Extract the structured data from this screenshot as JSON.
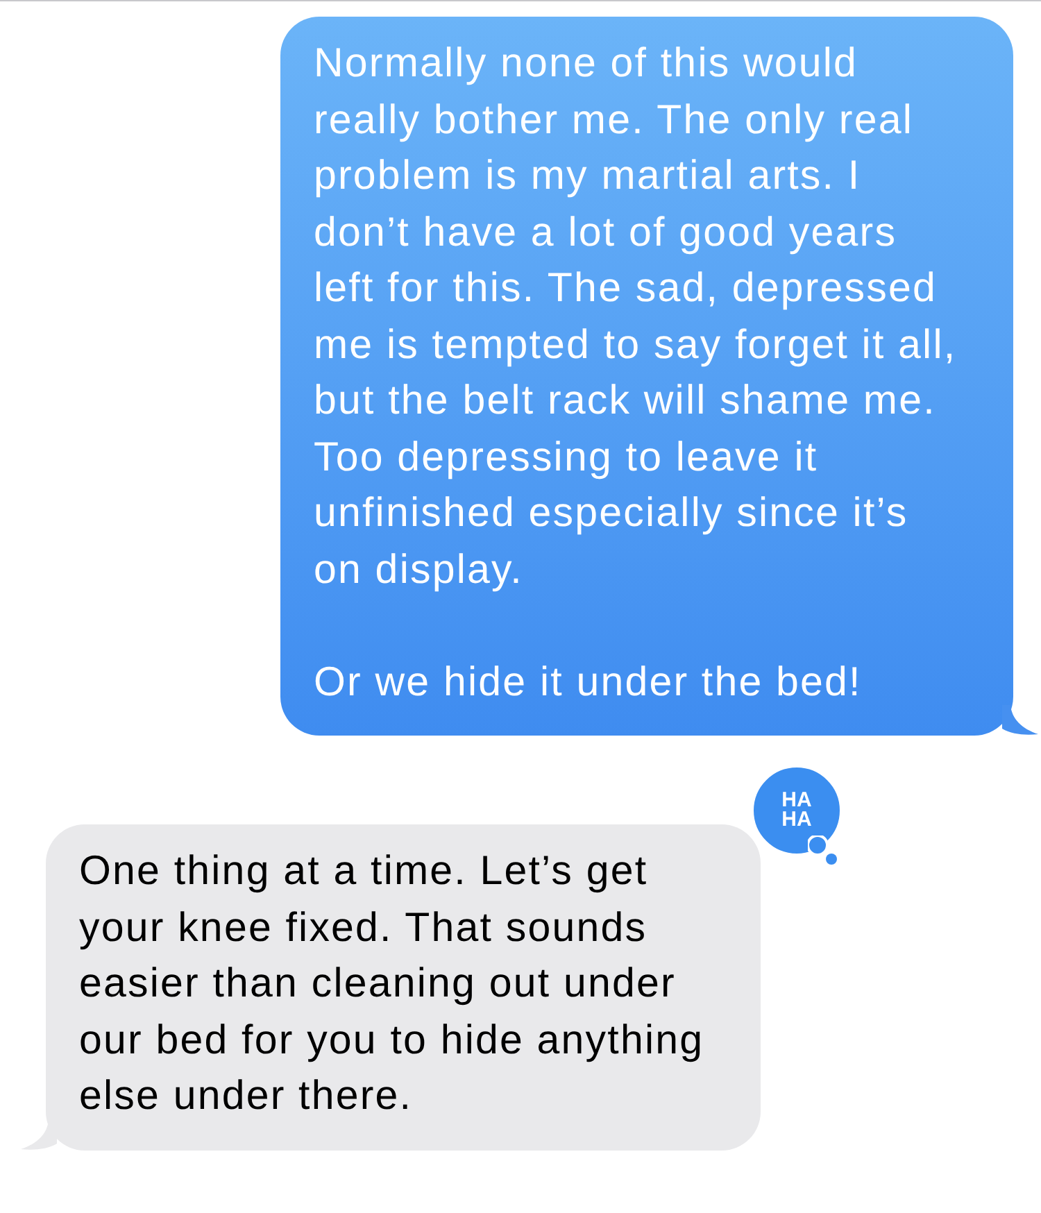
{
  "messages": [
    {
      "kind": "sent",
      "paragraphs": [
        "Normally none of this would really bother me. The only real problem is my martial arts. I don’t have a lot of good years left for this. The sad, depressed me is tempted to say forget it all, but the belt rack will shame me. Too depressing to leave it unfinished especially since it’s on display.",
        "Or we hide it under the bed!"
      ]
    },
    {
      "kind": "received",
      "reaction": [
        "HA",
        "HA"
      ],
      "paragraphs": [
        "One thing at a time. Let’s get your knee fixed. That sounds easier than cleaning out under our bed for you to hide anything else under there."
      ]
    }
  ]
}
